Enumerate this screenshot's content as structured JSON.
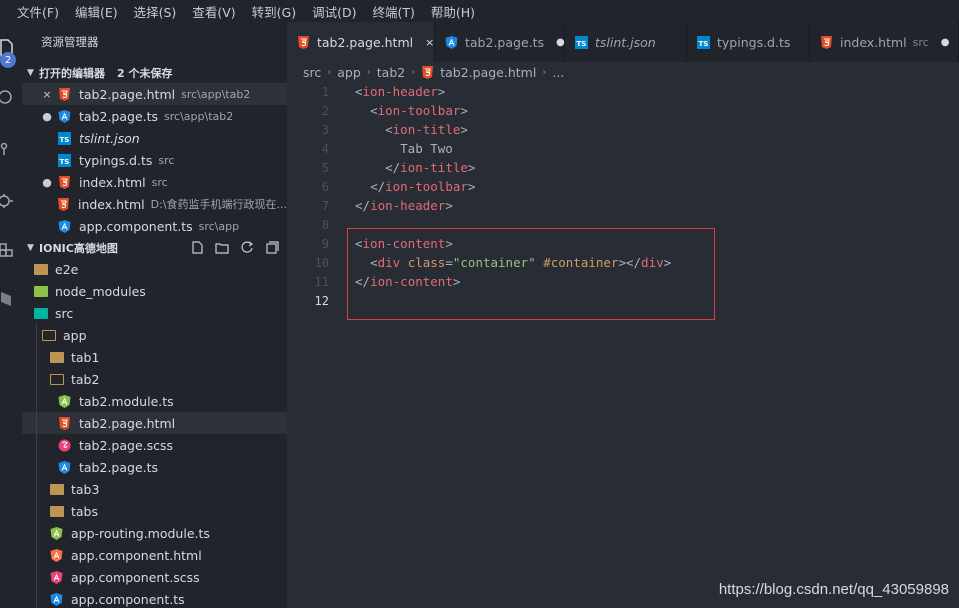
{
  "menu": [
    "文件(F)",
    "编辑(E)",
    "选择(S)",
    "查看(V)",
    "转到(G)",
    "调试(D)",
    "终端(T)",
    "帮助(H)"
  ],
  "activity": {
    "badge": "2"
  },
  "sidebar": {
    "title": "资源管理器",
    "open_editors": {
      "label": "打开的编辑器",
      "unsaved": "2 个未保存",
      "items": [
        {
          "name": "tab2.page.html",
          "path": "src\\app\\tab2",
          "lead": "×",
          "icon": "html5-icon"
        },
        {
          "name": "tab2.page.ts",
          "path": "src\\app\\tab2",
          "lead": "●",
          "icon": "angular-icon"
        },
        {
          "name": "tslint.json",
          "path": "",
          "lead": "",
          "icon": "ts-icon"
        },
        {
          "name": "typings.d.ts",
          "path": "src",
          "lead": "",
          "icon": "ts-icon"
        },
        {
          "name": "index.html",
          "path": "src",
          "lead": "●",
          "icon": "html5-icon"
        },
        {
          "name": "index.html",
          "path": "D:\\食药监手机端行政现在...",
          "lead": "",
          "icon": "html5-icon"
        },
        {
          "name": "app.component.ts",
          "path": "src\\app",
          "lead": "",
          "icon": "angular-icon"
        }
      ]
    },
    "project": {
      "label": "IONIC高德地图",
      "tree": [
        {
          "name": "e2e",
          "type": "folder"
        },
        {
          "name": "node_modules",
          "type": "folder-node"
        },
        {
          "name": "src",
          "type": "folder-src"
        },
        {
          "name": "app",
          "type": "folder-open"
        },
        {
          "name": "tab1",
          "type": "folder"
        },
        {
          "name": "tab2",
          "type": "folder-open"
        },
        {
          "name": "tab2.module.ts",
          "type": "angular-module"
        },
        {
          "name": "tab2.page.html",
          "type": "html"
        },
        {
          "name": "tab2.page.scss",
          "type": "scss"
        },
        {
          "name": "tab2.page.ts",
          "type": "angular"
        },
        {
          "name": "tab3",
          "type": "folder"
        },
        {
          "name": "tabs",
          "type": "folder"
        },
        {
          "name": "app-routing.module.ts",
          "type": "angular-module"
        },
        {
          "name": "app.component.html",
          "type": "angular-html"
        },
        {
          "name": "app.component.scss",
          "type": "angular-scss"
        },
        {
          "name": "app.component.ts",
          "type": "angular"
        }
      ]
    }
  },
  "tabs": [
    {
      "name": "tab2.page.html",
      "desc": "",
      "action": "×",
      "icon": "html5-icon",
      "active": true
    },
    {
      "name": "tab2.page.ts",
      "desc": "",
      "action": "●",
      "icon": "angular-icon"
    },
    {
      "name": "tslint.json",
      "desc": "",
      "action": "",
      "icon": "ts-icon",
      "italic": true
    },
    {
      "name": "typings.d.ts",
      "desc": "",
      "action": "",
      "icon": "ts-icon"
    },
    {
      "name": "index.html",
      "desc": "src",
      "action": "●",
      "icon": "html5-icon"
    }
  ],
  "breadcrumb": [
    "src",
    "app",
    "tab2",
    "tab2.page.html",
    "..."
  ],
  "code_lines": [
    {
      "n": "1",
      "html": "<span class=\"punc\">&lt;</span><span class=\"tag\">ion-header</span><span class=\"punc\">&gt;</span>"
    },
    {
      "n": "2",
      "html": "  <span class=\"punc\">&lt;</span><span class=\"tag\">ion-toolbar</span><span class=\"punc\">&gt;</span>"
    },
    {
      "n": "3",
      "html": "    <span class=\"punc\">&lt;</span><span class=\"tag\">ion-title</span><span class=\"punc\">&gt;</span>"
    },
    {
      "n": "4",
      "html": "      <span class=\"txt\">Tab Two</span>"
    },
    {
      "n": "5",
      "html": "    <span class=\"punc\">&lt;/</span><span class=\"tag\">ion-title</span><span class=\"punc\">&gt;</span>"
    },
    {
      "n": "6",
      "html": "  <span class=\"punc\">&lt;/</span><span class=\"tag\">ion-toolbar</span><span class=\"punc\">&gt;</span>"
    },
    {
      "n": "7",
      "html": "<span class=\"punc\">&lt;/</span><span class=\"tag\">ion-header</span><span class=\"punc\">&gt;</span>"
    },
    {
      "n": "8",
      "html": ""
    },
    {
      "n": "9",
      "html": "<span class=\"punc\">&lt;</span><span class=\"tag\">ion-content</span><span class=\"punc\">&gt;</span>"
    },
    {
      "n": "10",
      "html": "  <span class=\"punc\">&lt;</span><span class=\"tag\">div</span> <span class=\"attr\">class</span><span class=\"punc\">=</span><span class=\"str\">\"container\"</span> <span class=\"attr\">#container</span><span class=\"punc\">&gt;&lt;/</span><span class=\"tag\">div</span><span class=\"punc\">&gt;</span>"
    },
    {
      "n": "11",
      "html": "<span class=\"punc\">&lt;/</span><span class=\"tag\">ion-content</span><span class=\"punc\">&gt;</span>"
    },
    {
      "n": "12",
      "html": ""
    }
  ],
  "watermark": "https://blog.csdn.net/qq_43059898"
}
